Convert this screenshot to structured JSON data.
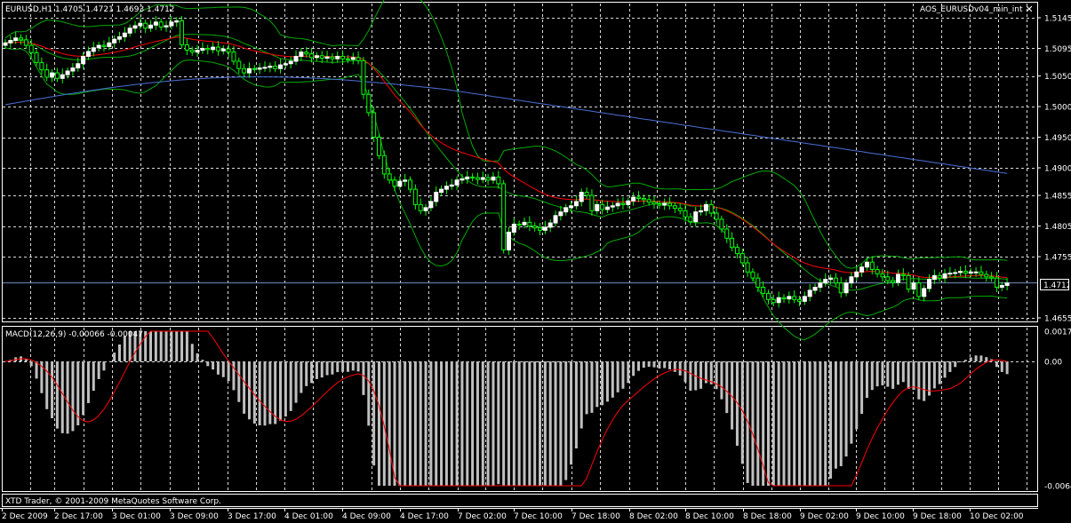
{
  "header": {
    "symbol_info": "EURUSD,H1  1.4705 1.4721 1.4693 1.4712",
    "indicator_name": "AOS_EURUSDv04_min_int",
    "close_icon": "close-icon"
  },
  "macd_label": "MACD(12,26,9) -0.00066 -0.00047",
  "copyright": "XTD Trader, © 2001-2009 MetaQuotes Software Corp.",
  "current_price": "1.4712",
  "colors": {
    "background": "#000000",
    "grid": "#ffffff",
    "bull_candle": "#ffffff",
    "bear_candle": "#00ff00",
    "bollinger": "#00aa00",
    "ma_fast": "#ff0000",
    "ma_slow": "#4a6fd8",
    "macd_hist": "#c0c0c0",
    "macd_signal": "#ff0000",
    "price_line": "#7090c0"
  },
  "chart_data": [
    {
      "type": "candlestick",
      "symbol": "EURUSD",
      "timeframe": "H1",
      "ylim": [
        1.4655,
        1.517
      ],
      "y_ticks": [
        "1.5145",
        "1.5095",
        "1.5050",
        "1.5000",
        "1.4950",
        "1.4900",
        "1.4855",
        "1.4805",
        "1.4755",
        "1.4712",
        "1.4655"
      ],
      "x_ticks": [
        "2 Dec 2009",
        "2 Dec 17:00",
        "3 Dec 01:00",
        "3 Dec 09:00",
        "3 Dec 17:00",
        "4 Dec 01:00",
        "4 Dec 09:00",
        "4 Dec 17:00",
        "7 Dec 02:00",
        "7 Dec 10:00",
        "7 Dec 18:00",
        "8 Dec 02:00",
        "8 Dec 10:00",
        "8 Dec 18:00",
        "9 Dec 02:00",
        "9 Dec 10:00",
        "9 Dec 18:00",
        "10 Dec 02:00"
      ],
      "close": [
        1.5104,
        1.5108,
        1.5112,
        1.5109,
        1.51,
        1.5088,
        1.5072,
        1.506,
        1.5048,
        1.5055,
        1.5046,
        1.5052,
        1.5058,
        1.5063,
        1.507,
        1.5082,
        1.509,
        1.5096,
        1.51,
        1.5098,
        1.5104,
        1.511,
        1.5114,
        1.512,
        1.5128,
        1.5132,
        1.5136,
        1.5128,
        1.5133,
        1.5138,
        1.513,
        1.5132,
        1.5138,
        1.514,
        1.5101,
        1.5092,
        1.5089,
        1.5092,
        1.5095,
        1.5093,
        1.5097,
        1.5091,
        1.5094,
        1.5089,
        1.5074,
        1.5062,
        1.5055,
        1.5062,
        1.5061,
        1.5063,
        1.5064,
        1.5066,
        1.5062,
        1.5068,
        1.507,
        1.5074,
        1.5082,
        1.5089,
        1.5086,
        1.508,
        1.5083,
        1.5079,
        1.5081,
        1.5078,
        1.5082,
        1.5078,
        1.5077,
        1.508,
        1.5075,
        1.502,
        1.499,
        1.495,
        1.492,
        1.489,
        1.488,
        1.487,
        1.4878,
        1.488,
        1.4865,
        1.484,
        1.483,
        1.4835,
        1.4845,
        1.486,
        1.4865,
        1.487,
        1.4872,
        1.488,
        1.4882,
        1.4885,
        1.4884,
        1.4881,
        1.4884,
        1.488,
        1.4885,
        1.4874,
        1.4766,
        1.4795,
        1.4808,
        1.4807,
        1.4811,
        1.4805,
        1.4802,
        1.4798,
        1.4803,
        1.481,
        1.4822,
        1.4828,
        1.4835,
        1.4838,
        1.4845,
        1.486,
        1.4855,
        1.483,
        1.484,
        1.4832,
        1.4836,
        1.4838,
        1.4842,
        1.484,
        1.4846,
        1.4852,
        1.485,
        1.4848,
        1.4844,
        1.4841,
        1.4839,
        1.4842,
        1.4838,
        1.4834,
        1.483,
        1.482,
        1.4812,
        1.4828,
        1.483,
        1.484,
        1.4826,
        1.4816,
        1.48,
        1.4785,
        1.477,
        1.476,
        1.4745,
        1.473,
        1.472,
        1.4705,
        1.4695,
        1.4685,
        1.468,
        1.4688,
        1.4686,
        1.469,
        1.4685,
        1.4682,
        1.469,
        1.47,
        1.4705,
        1.4712,
        1.4718,
        1.472,
        1.4712,
        1.4696,
        1.4712,
        1.4722,
        1.473,
        1.4738,
        1.4746,
        1.4734,
        1.4727,
        1.4722,
        1.4716,
        1.4713,
        1.4726,
        1.4724,
        1.4702,
        1.4712,
        1.469,
        1.4703,
        1.4718,
        1.4724,
        1.472,
        1.4727,
        1.4728,
        1.4729,
        1.4731,
        1.4728,
        1.473,
        1.473,
        1.4726,
        1.4722,
        1.472,
        1.4705,
        1.4708,
        1.4712
      ]
    },
    {
      "type": "bar",
      "indicator": "MACD(12,26,9)",
      "ylim": [
        -0.00645,
        0.00177
      ],
      "y_ticks": [
        "0.00177",
        "0.00",
        "-0.00645"
      ],
      "histogram_value": -0.00066,
      "signal_value": -0.00047
    }
  ]
}
